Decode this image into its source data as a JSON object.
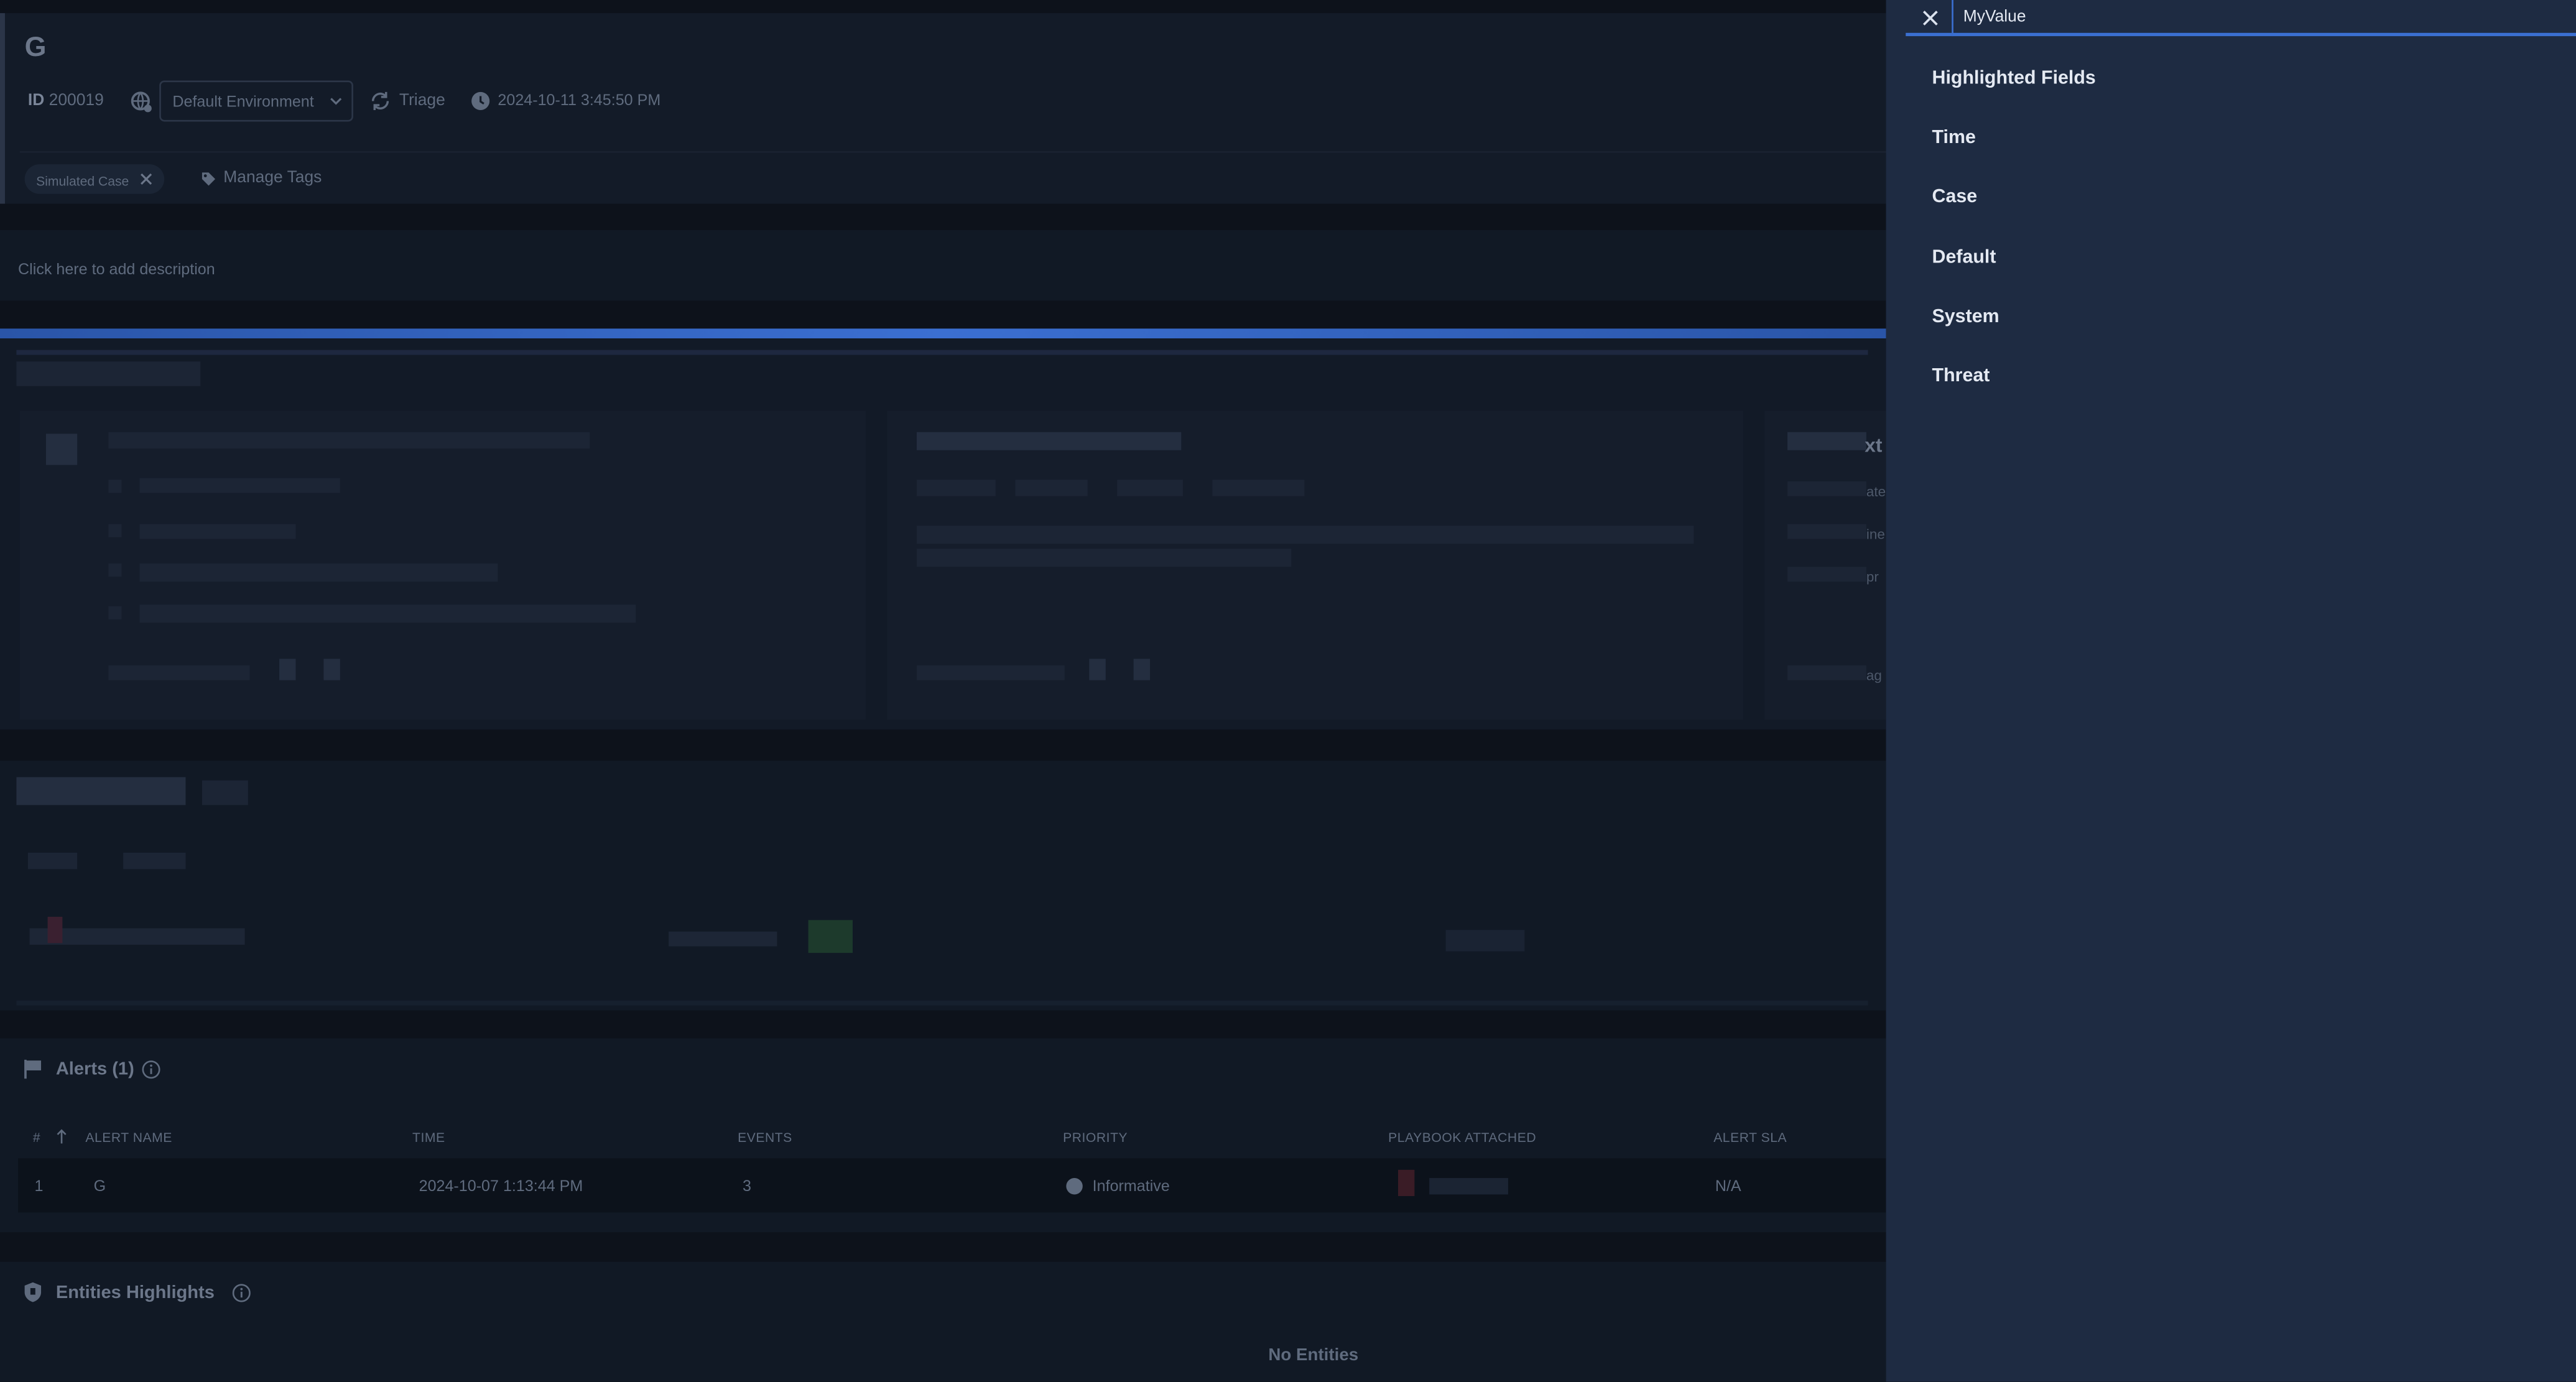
{
  "case": {
    "title": "G",
    "id_label": "ID",
    "id_value": "200019",
    "environment": "Default Environment",
    "stage": "Triage",
    "created": "2024-10-11 3:45:50 PM",
    "tags": [
      "Simulated Case"
    ],
    "manage_tags_label": "Manage Tags",
    "description_placeholder": "Click here to add description"
  },
  "partial_text": {
    "widget_title_fragment": "xt",
    "line1": "ate",
    "line2": "ine",
    "line3": "pr",
    "line4": "ag"
  },
  "alerts": {
    "title": "Alerts (1)",
    "columns": [
      "#",
      "ALERT NAME",
      "TIME",
      "EVENTS",
      "PRIORITY",
      "PLAYBOOK ATTACHED",
      "ALERT SLA"
    ],
    "rows": [
      {
        "num": "1",
        "name": "G",
        "time": "2024-10-07 1:13:44 PM",
        "events": "3",
        "priority": "Informative",
        "sla": "N/A"
      }
    ]
  },
  "entities": {
    "title": "Entities Highlights",
    "empty_text": "No Entities"
  },
  "field_search": {
    "value": "MyValue",
    "sections": [
      "Highlighted Fields",
      "Time",
      "Case",
      "Default",
      "System",
      "Threat"
    ]
  },
  "colors": {
    "accent": "#3b6fd1",
    "panel": "#1e2b42",
    "background": "#0d121b"
  }
}
